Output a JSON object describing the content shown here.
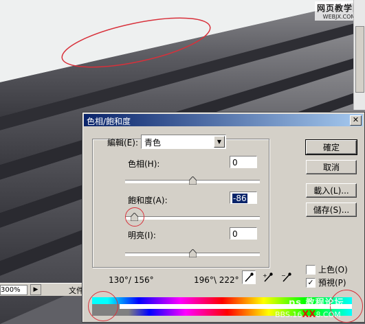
{
  "status": {
    "zoom": "300%",
    "doc_label": "文件"
  },
  "watermark_top": {
    "line1": "网页教学网",
    "line2": "WEBJX.COM"
  },
  "watermark_bottom": {
    "line1": "ps 教程论坛",
    "line2_prefix": "BBS.16",
    "line2_mark": "XX",
    "line2_suffix": "8.COM"
  },
  "dialog": {
    "title": "色相/飽和度",
    "close": "✕",
    "edit_label": "編輯(E):",
    "edit_value": "青色",
    "hue": {
      "label": "色相(H):",
      "value": "0",
      "level": 0.5
    },
    "saturation": {
      "label": "飽和度(A):",
      "value": "-86",
      "level": 0.07
    },
    "lightness": {
      "label": "明亮(I):",
      "value": "0",
      "level": 0.5
    },
    "buttons": {
      "ok": "確定",
      "cancel": "取消",
      "load": "載入(L)...",
      "save": "儲存(S)..."
    },
    "range_left": "130°/ 156°",
    "range_right": "196°\\ 222°",
    "colorize": {
      "label": "上色(O)",
      "checked": false
    },
    "preview": {
      "label": "預視(P)",
      "checked": true,
      "mark": "✓"
    }
  }
}
